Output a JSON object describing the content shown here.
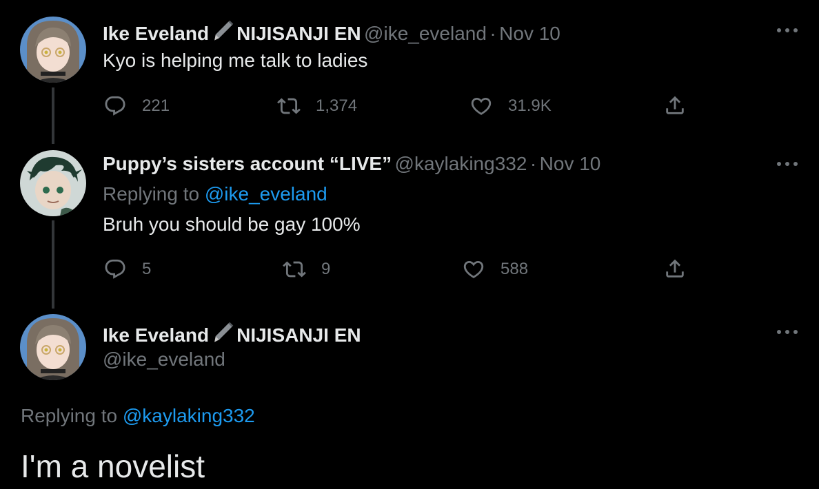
{
  "tweets": [
    {
      "author_name": "Ike Eveland",
      "author_suffix": "NIJISANJI EN",
      "handle": "@ike_eveland",
      "separator": "·",
      "date": "Nov 10",
      "text": "Kyo is helping me talk to ladies",
      "replies": "221",
      "retweets": "1,374",
      "likes": "31.9K"
    },
    {
      "author_name": "Puppy’s sisters account “LIVE”",
      "handle": "@kaylaking332",
      "separator": "·",
      "date": "Nov 10",
      "replying_prefix": "Replying to",
      "replying_to": "@ike_eveland",
      "text": "Bruh you should be gay 100%",
      "replies": "5",
      "retweets": "9",
      "likes": "588"
    }
  ],
  "main_tweet": {
    "author_name": "Ike Eveland",
    "author_suffix": "NIJISANJI EN",
    "handle": "@ike_eveland",
    "replying_prefix": "Replying to",
    "replying_to": "@kaylaking332",
    "text": "I'm a novelist"
  },
  "colors": {
    "background": "#000000",
    "text": "#e7e9ea",
    "muted": "#71767b",
    "link": "#1d9bf0",
    "thread_line": "#333639"
  },
  "icons": [
    "reply-icon",
    "retweet-icon",
    "like-icon",
    "share-icon",
    "more-icon",
    "pen-icon"
  ]
}
